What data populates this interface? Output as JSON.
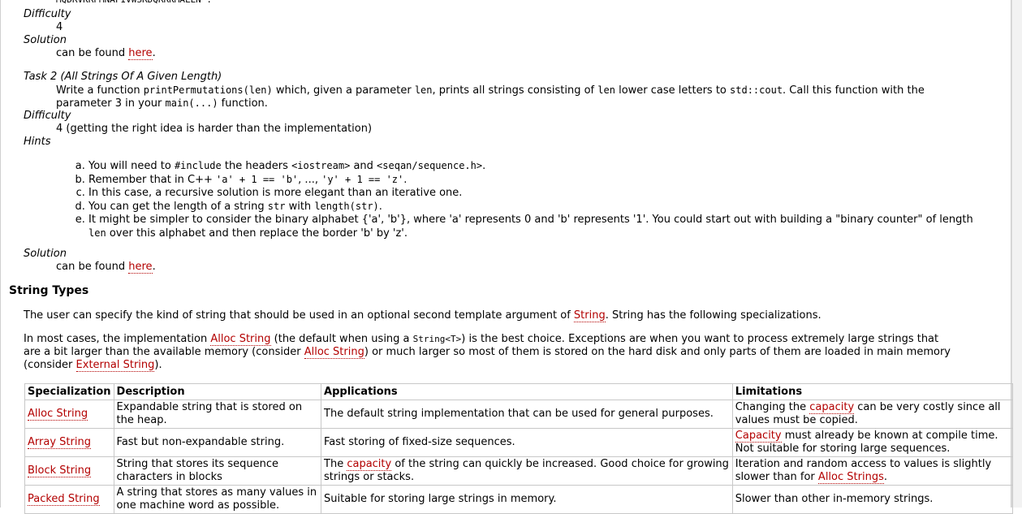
{
  "top_cut_text": "MQDRVKRPMNAFIVWSRDQRRKMALEN\".",
  "task1": {
    "difficulty_label": "Difficulty",
    "difficulty_value": "4",
    "solution_label": "Solution",
    "solution_prefix": "can be found ",
    "solution_link": "here",
    "solution_suffix": "."
  },
  "task2": {
    "title": "Task 2 (All Strings Of A Given Length)",
    "desc_1": "Write a function ",
    "desc_code_1": "printPermutations(len)",
    "desc_2": " which, given a parameter ",
    "desc_code_2": "len",
    "desc_3": ", prints all strings consisting of ",
    "desc_code_3": "len",
    "desc_4": " lower case letters to ",
    "desc_code_4": "std::cout",
    "desc_5": ". Call this function with the",
    "desc_line2_1": "parameter 3 in your ",
    "desc_line2_code": "main(...)",
    "desc_line2_2": " function.",
    "difficulty_label": "Difficulty",
    "difficulty_value": "4 (getting the right idea is harder than the implementation)",
    "hints_label": "Hints",
    "hints": {
      "a_1": "You will need to ",
      "a_code_1": "#include",
      "a_2": " the headers ",
      "a_code_2": "<iostream>",
      "a_3": " and ",
      "a_code_3": "<seqan/sequence.h>",
      "a_4": ".",
      "b_1": "Remember that in C++ ",
      "b_code_1": "'a' + 1 == 'b'",
      "b_2": ", ..., ",
      "b_code_2": "'y' + 1 == 'z'",
      "b_3": ".",
      "c": "In this case, a recursive solution is more elegant than an iterative one.",
      "d_1": "You can get the length of a string ",
      "d_code_1": "str",
      "d_2": " with ",
      "d_code_2": "length(str)",
      "d_3": ".",
      "e_1": "It might be simpler to consider the binary alphabet {'a', 'b'}, where 'a' represents 0 and 'b' represents '1'. You could start out with building a \"binary counter\" of length",
      "e_code": "len",
      "e_2": " over this alphabet and then replace the border 'b' by 'z'."
    },
    "solution_label": "Solution",
    "solution_prefix": "can be found ",
    "solution_link": "here",
    "solution_suffix": "."
  },
  "string_types": {
    "heading": "String Types",
    "p1_1": "The user can specify the kind of string that should be used in an optional second template argument of ",
    "p1_link": "String",
    "p1_2": ". String has the following specializations.",
    "p2_1": "In most cases, the implementation ",
    "p2_link1": "Alloc String",
    "p2_2": " (the default when using a ",
    "p2_code": "String<T>",
    "p2_3": ") is the best choice. Exceptions are when you want to process extremely large strings that",
    "p2_line2_1": "are a bit larger than the available memory (consider ",
    "p2_line2_link": "Alloc String",
    "p2_line2_2": ") or much larger so most of them is stored on the hard disk and only parts of them are loaded in main memory",
    "p2_line3_1": "(consider ",
    "p2_line3_link": "External String",
    "p2_line3_2": ")."
  },
  "table": {
    "headers": [
      "Specialization",
      "Description",
      "Applications",
      "Limitations"
    ],
    "rows": [
      {
        "spec": "Alloc String",
        "desc": "Expandable string that is stored on the heap.",
        "app_1": "The default string implementation that can be used for general purposes.",
        "lim_1": "Changing the ",
        "lim_link": "capacity",
        "lim_2": " can be very costly since all values must be copied."
      },
      {
        "spec": "Array String",
        "desc": "Fast but non-expandable string.",
        "app_1": "Fast storing of fixed-size sequences.",
        "lim_1": "",
        "lim_link": "Capacity",
        "lim_2": " must already be known at compile time. Not suitable for storing large sequences."
      },
      {
        "spec": "Block String",
        "desc": "String that stores its sequence characters in blocks",
        "app_1": "The ",
        "app_link": "capacity",
        "app_2": " of the string can quickly be increased. Good choice for growing strings or stacks.",
        "lim_1": "Iteration and random access to values is slightly slower than for ",
        "lim_link": "Alloc Strings",
        "lim_2": "."
      },
      {
        "spec": "Packed String",
        "desc": "A string that stores as many values in one machine word as possible.",
        "app_1": "Suitable for storing large strings in memory.",
        "lim_1": "Slower than other in-memory strings.",
        "lim_link": "",
        "lim_2": ""
      }
    ]
  }
}
